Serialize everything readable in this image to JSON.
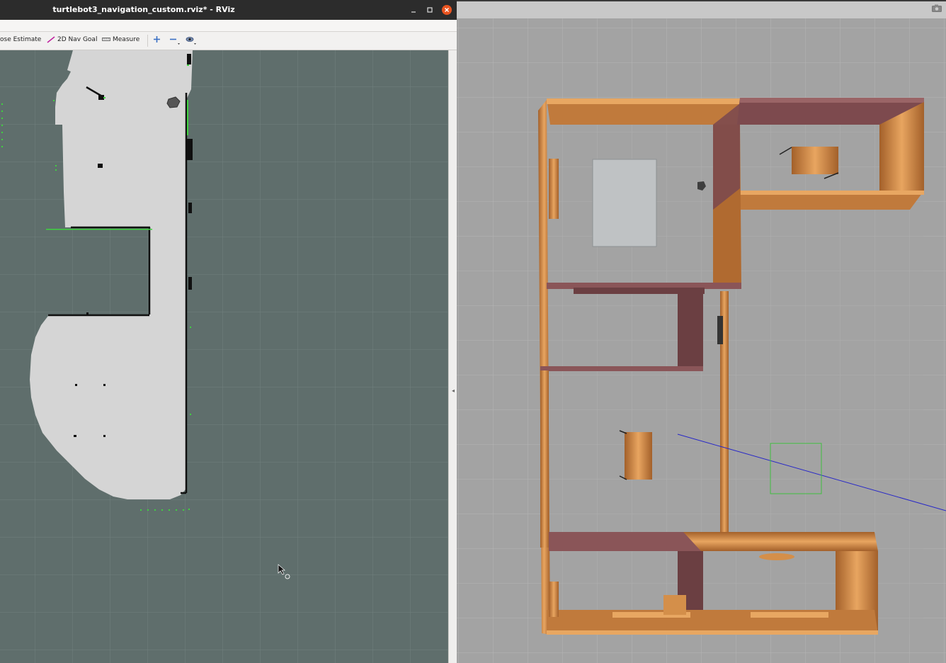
{
  "window": {
    "title": "turtlebot3_navigation_custom.rviz* - RViz",
    "minimize_icon": "minimize-icon",
    "maximize_icon": "maximize-icon",
    "close_icon": "close-icon"
  },
  "toolbar": {
    "pose_estimate_label": "ose Estimate",
    "nav_goal_label": "2D Nav Goal",
    "measure_label": "Measure",
    "icons": [
      "nav-goal-arrow-icon",
      "ruler-icon",
      "add-tool-icon",
      "remove-tool-icon",
      "camera-view-icon"
    ]
  },
  "viewport": {
    "background_color": "#5f6e6c",
    "free_space_color": "#d5d5d5",
    "wall_color": "#101010",
    "scan_color": "#33cc33"
  },
  "gazebo": {
    "camera_icon": "screenshot-camera-icon",
    "floor_color": "#a3a3a3",
    "wall_color": "#c8843d",
    "brick_color": "#7d4a4e"
  }
}
